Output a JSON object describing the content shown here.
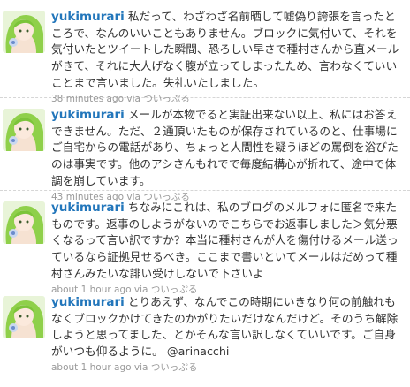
{
  "tweets": [
    {
      "username": "yukimurari",
      "text": "私だって、わざわざ名前晒して嘘偽り誇張を言ったところで、なんのいいこともありません。ブロックに気付いて、それを気付いたとツイートした瞬間、恐ろしい早さで種村さんから直メールがきて、それに大人げなく腹が立ってしまったため、言わなくていいことまで言いました。失礼いたしました。",
      "time": "38 minutes ago",
      "via": "via",
      "client": "ついっぷる"
    },
    {
      "username": "yukimurari",
      "text": "メールが本物でると実証出来ない以上、私にはお答えできません。ただ、２通頂いたものが保存されているのと、仕事場にご自宅からの電話があり、ちょっと人間性を疑うほどの罵倒を浴びたのは事実です。他のアシさんもれでで毎度結構心が折れて、途中で体調を崩しています。",
      "time": "43 minutes ago",
      "via": "via",
      "client": "ついっぷる"
    },
    {
      "username": "yukimurari",
      "text": "ちなみにこれは、私のブログのメルフォに匿名で来たものです。返事のしようがないのでこちらでお返事しました＞気分悪くなるって言い訳ですか？本当に種村さんが人を傷付けるメール送っているなら証拠見せるべき。ここまで書いといてメールはだめって種村さんみたいな誹い受けしないで下さいよ",
      "time": "about 1 hour ago",
      "via": "via",
      "client": "ついっぷる"
    },
    {
      "username": "yukimurari",
      "text": "とりあえず、なんでこの時期にいきなり何の前触れもなくブロックかけてきたのかがりたいだけなんだけど。そのうち解除しようと思ってました、とかそんな言い訳しなくていいです。ご自身がいつも仰るように。",
      "mention": "@arinacchi",
      "time": "about 1 hour ago",
      "via": "via",
      "client": "ついっぷる"
    }
  ],
  "colors": {
    "username": "#2276bb",
    "text": "#333333",
    "meta": "#999999",
    "separator": "#d6d6d6"
  }
}
